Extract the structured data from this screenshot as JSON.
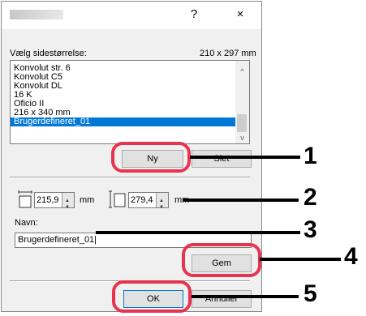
{
  "dialog": {
    "help_glyph": "?",
    "close_glyph": "×"
  },
  "paper": {
    "label": "Vælg sidestørrelse:",
    "dimensions": "210 x 297 mm",
    "items": [
      "Konvolut str. 6",
      "Konvolut C5",
      "Konvolut DL",
      "16 K",
      "Oficio II",
      "216 x 340 mm",
      "Brugerdefineret_01"
    ],
    "selected_index": 6,
    "scroll_up": "^",
    "scroll_down": "v"
  },
  "buttons": {
    "new": "Ny",
    "delete": "Slet",
    "save": "Gem",
    "ok": "OK",
    "cancel": "Annuller"
  },
  "size": {
    "width_value": "215,9",
    "height_value": "279,4",
    "unit": "mm"
  },
  "name": {
    "label": "Navn:",
    "value": "Brugerdefineret_01|"
  },
  "callouts": [
    "1",
    "2",
    "3",
    "4",
    "5"
  ],
  "colors": {
    "callout": "#e8344e",
    "selection": "#0078d7"
  }
}
